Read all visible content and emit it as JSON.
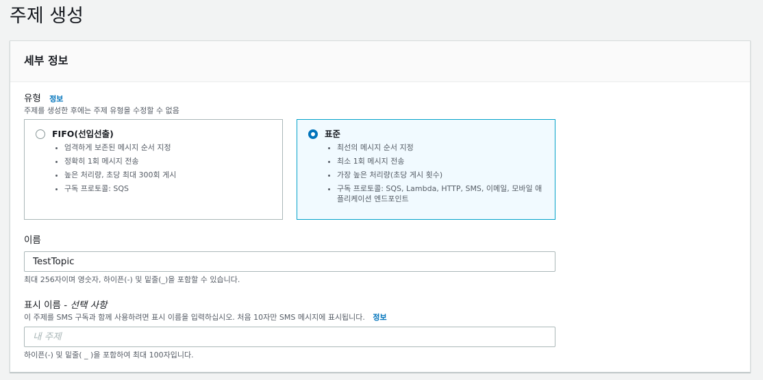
{
  "page": {
    "title": "주제 생성"
  },
  "details": {
    "header": "세부 정보",
    "type": {
      "label": "유형",
      "info_link": "정보",
      "description": "주제를 생성한 후에는 주제 유형을 수정할 수 없음",
      "options": [
        {
          "title": "FIFO(선입선출)",
          "selected": false,
          "bullets": [
            "엄격하게 보존된 메시지 순서 지정",
            "정확히 1회 메시지 전송",
            "높은 처리량, 초당 최대 300회 게시",
            "구독 프로토콜: SQS"
          ]
        },
        {
          "title": "표준",
          "selected": true,
          "bullets": [
            "최선의 메시지 순서 지정",
            "최소 1회 메시지 전송",
            "가장 높은 처리량(초당 게시 횟수)",
            "구독 프로토콜: SQS, Lambda, HTTP, SMS, 이메일, 모바일 애플리케이션 엔드포인트"
          ]
        }
      ]
    },
    "name": {
      "label": "이름",
      "value": "TestTopic",
      "hint": "최대 256자이며 영숫자, 하이픈(-) 및 밑줄(_)을 포함할 수 있습니다."
    },
    "display_name": {
      "label": "표시 이름 - ",
      "optional": "선택 사항",
      "description": "이 주제를 SMS 구독과 함께 사용하려면 표시 이름을 입력하십시오. 처음 10자만 SMS 메시지에 표시됩니다.",
      "info_link": "정보",
      "placeholder": "내 주제",
      "hint": "하이픈(-) 및 밑줄( _ )을 포함하여 최대 100자입니다."
    }
  },
  "colors": {
    "accent": "#0073bb",
    "selected_border": "#00a1c9",
    "selected_bg": "#f1faff"
  }
}
